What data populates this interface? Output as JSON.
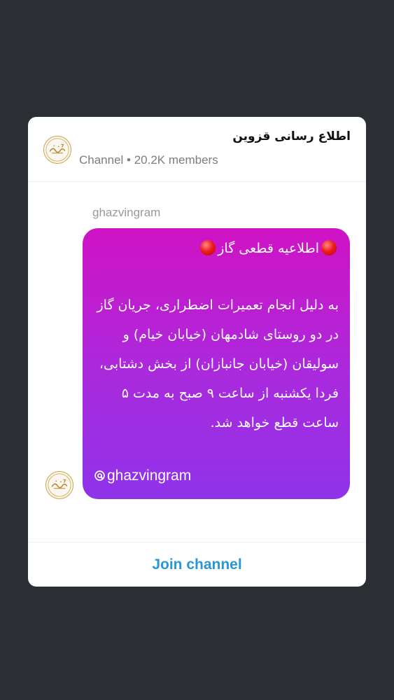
{
  "channel": {
    "title": "اطلاع رسانی قزوین",
    "meta": "Channel • 20.2K members",
    "avatar_icon": "qazvingram-logo-icon"
  },
  "message": {
    "sender": "ghazvingram",
    "title": "اطلاعیه قطعی گاز",
    "title_icon": "red-circle-icon",
    "body": "به دلیل انجام تعمیرات اضطراری، جریان گاز در دو روستای شادمهان (خیابان خیام) و سولیقان (خیابان جانبازان) از بخش دشتابی، فردا یکشنبه از ساعت ۹ صبح به مدت ۵ ساعت قطع خواهد شد.",
    "tag": "ghazvingram",
    "tag_icon": "threads-icon"
  },
  "join": {
    "label": "Join channel"
  },
  "colors": {
    "background": "#2b2e33",
    "card": "#ffffff",
    "bubble_gradient_top": "#cf13c4",
    "bubble_gradient_bottom": "#8f33e9",
    "accent": "#2b96d6",
    "avatar_border": "#c9a24a"
  }
}
